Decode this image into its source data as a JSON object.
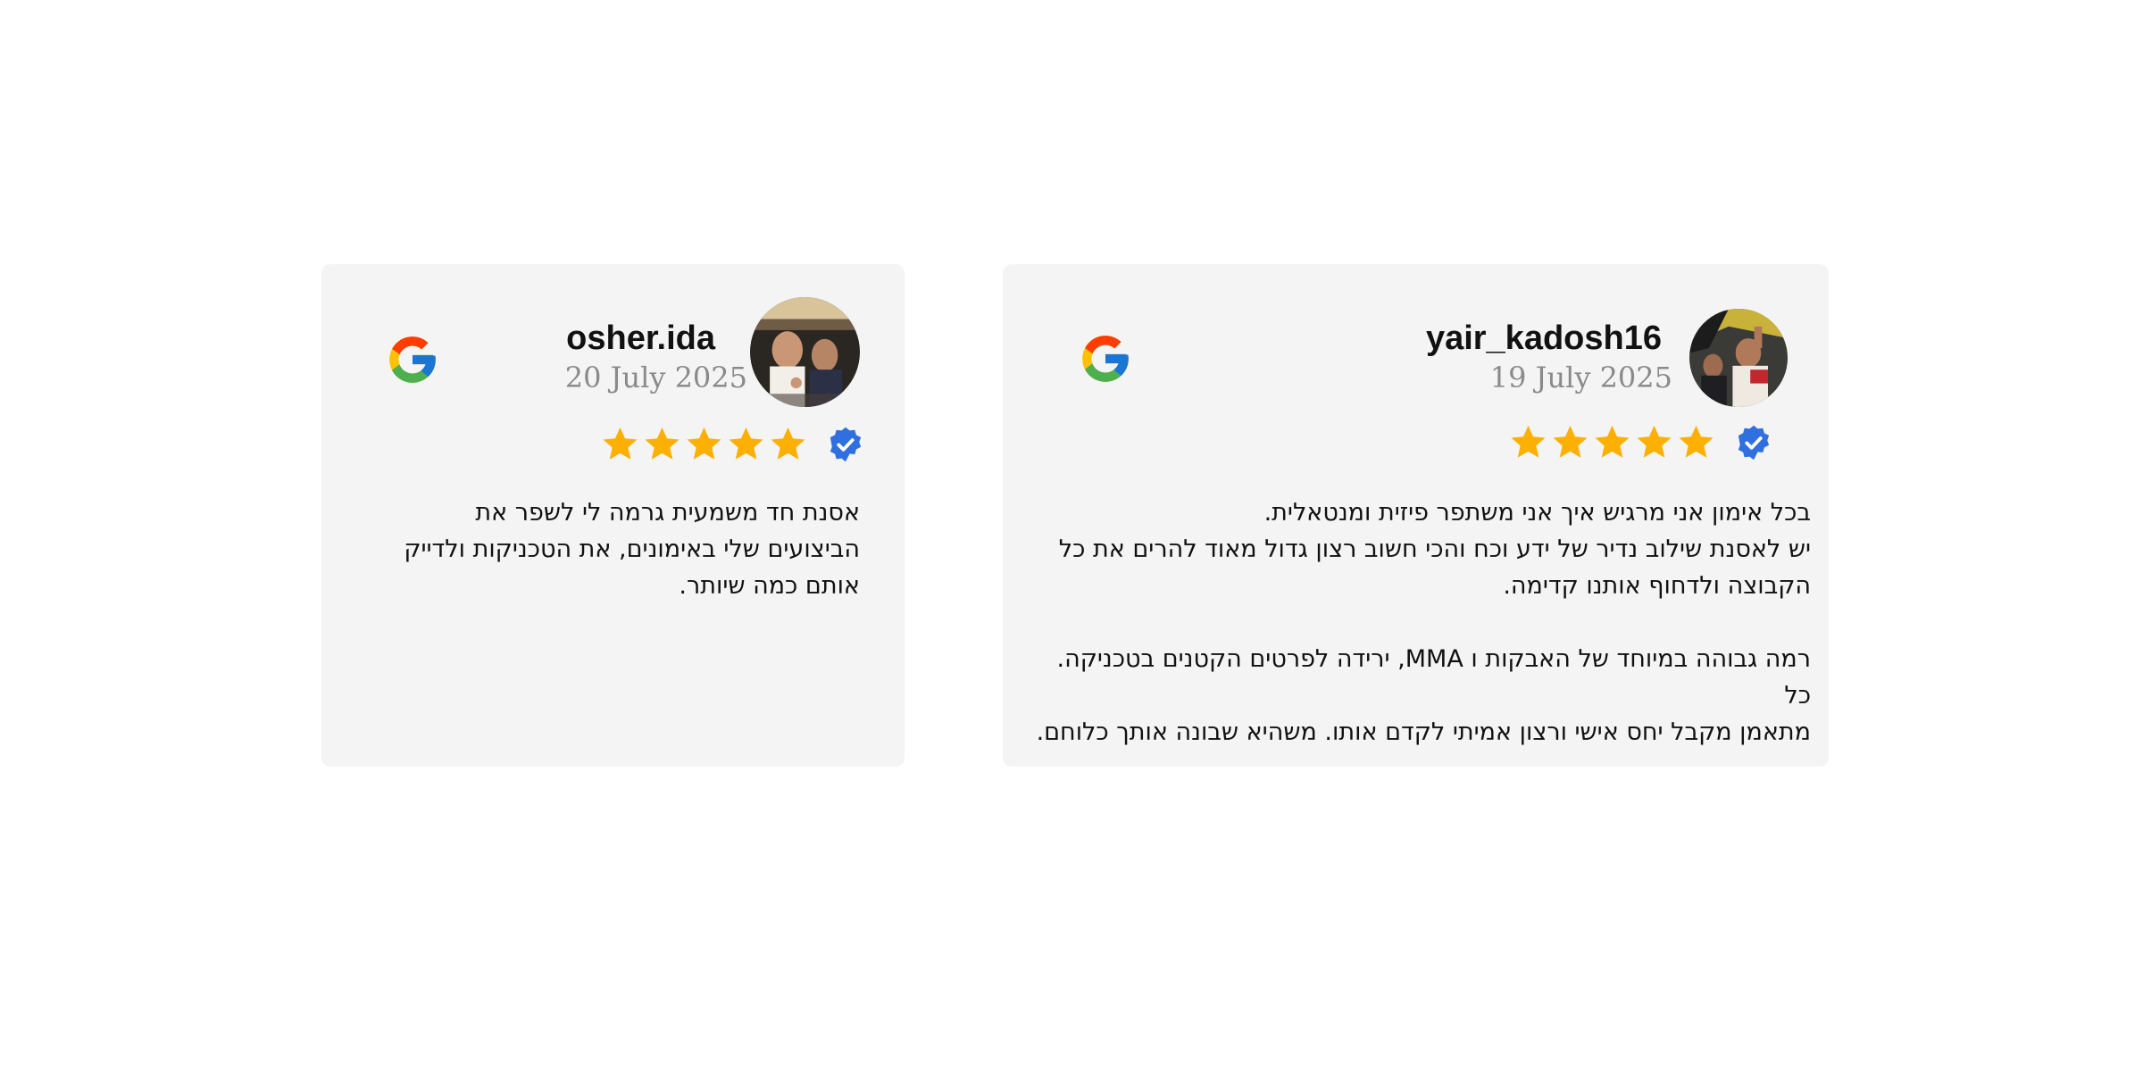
{
  "reviews": [
    {
      "name": "osher.ida",
      "date": "20 July 2025",
      "rating": 5,
      "verified": true,
      "text": "אסנת חד משמעית גרמה לי לשפר את\nהביצועים שלי באימונים, את הטכניקות ולדייק\nאותם כמה שיותר."
    },
    {
      "name": "yair_kadosh16",
      "date": "19 July 2025",
      "rating": 5,
      "verified": true,
      "text": "בכל אימון אני מרגיש איך אני משתפר פיזית ומנטאלית.\nיש לאסנת שילוב נדיר של ידע וכח והכי חשוב רצון גדול מאוד להרים את כל\nהקבוצה ולדחוף אותנו קדימה.\n\nרמה גבוהה במיוחד של האבקות ו MMA, ירידה לפרטים הקטנים בטכניקה. כל\nמתאמן מקבל יחס אישי ורצון אמיתי לקדם אותו. משהיא שבונה אותך כלוחם."
    }
  ],
  "colors": {
    "card_bg": "#f4f4f4",
    "star": "#fbb003",
    "verified_badge": "#2f6fe0",
    "google_blue": "#4285f4",
    "google_red": "#ea4335",
    "google_yellow": "#fbbc05",
    "google_green": "#34a853"
  },
  "icons": {
    "provider": "google-logo-icon",
    "star": "star-icon",
    "verified": "verified-badge-icon"
  }
}
